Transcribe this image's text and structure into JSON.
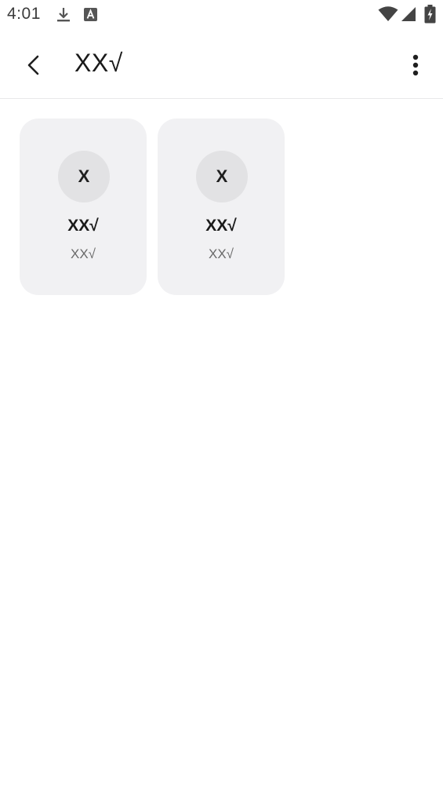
{
  "status_bar": {
    "time": "4:01",
    "icons": [
      "download-icon",
      "text-a-icon",
      "wifi-icon",
      "signal-icon",
      "battery-charging-icon"
    ]
  },
  "app_bar": {
    "title": "XX√",
    "back_icon": "chevron-left-icon",
    "more_icon": "more-vertical-icon"
  },
  "cards": [
    {
      "avatar": "X",
      "name": "XX√",
      "subtitle": "XX√"
    },
    {
      "avatar": "X",
      "name": "XX√",
      "subtitle": "XX√"
    }
  ]
}
